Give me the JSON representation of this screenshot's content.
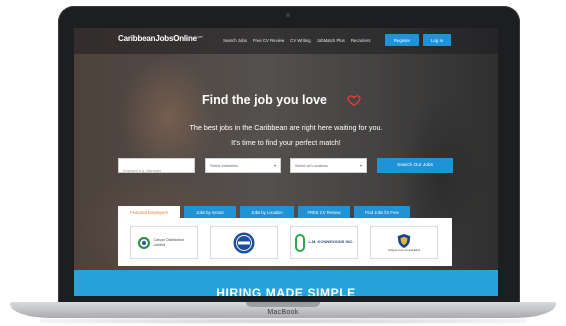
{
  "laptop": {
    "brand": "MacBook"
  },
  "site": {
    "logo": "CaribbeanJobsOnline",
    "logo_suffix": ".com"
  },
  "nav": {
    "items": [
      "Search Jobs",
      "Free CV Review",
      "CV Writing",
      "JobMatch Plus",
      "Recruiters"
    ],
    "register": "Register",
    "login": "Log in"
  },
  "hero": {
    "headline": "Find the job you love",
    "subline1": "The best jobs in the Caribbean are right here waiting for you.",
    "subline2": "It's time to find your perfect match!"
  },
  "search": {
    "keyword_placeholder": "Keyword e.g. Manager",
    "industry_value": "Select Industries...",
    "location_value": "Select all Locations",
    "button": "Search Our Jobs"
  },
  "tabs": [
    {
      "label": "Featured Employers",
      "active": true
    },
    {
      "label": "Jobs by Sector",
      "active": false
    },
    {
      "label": "Jobs by Location",
      "active": false
    },
    {
      "label": "FREE CV Review",
      "active": false
    },
    {
      "label": "Find Jobs for Free",
      "active": false
    }
  ],
  "employers": [
    {
      "name": "Carson Distribution Limited",
      "icon": "ring-logo-icon"
    },
    {
      "name": "",
      "icon": "badge-logo-icon"
    },
    {
      "name": "L.M. KONNEXIONS INC.",
      "icon": "konnexions-logo-icon"
    },
    {
      "name": "Antigua Commercial Bank",
      "icon": "shield-logo-icon"
    }
  ],
  "banner": {
    "title": "HIRING MADE SIMPLE"
  },
  "colors": {
    "accent": "#1f93d6",
    "heart": "#e53935",
    "active_tab_text": "#e8772e",
    "banner": "#27a3dc"
  }
}
